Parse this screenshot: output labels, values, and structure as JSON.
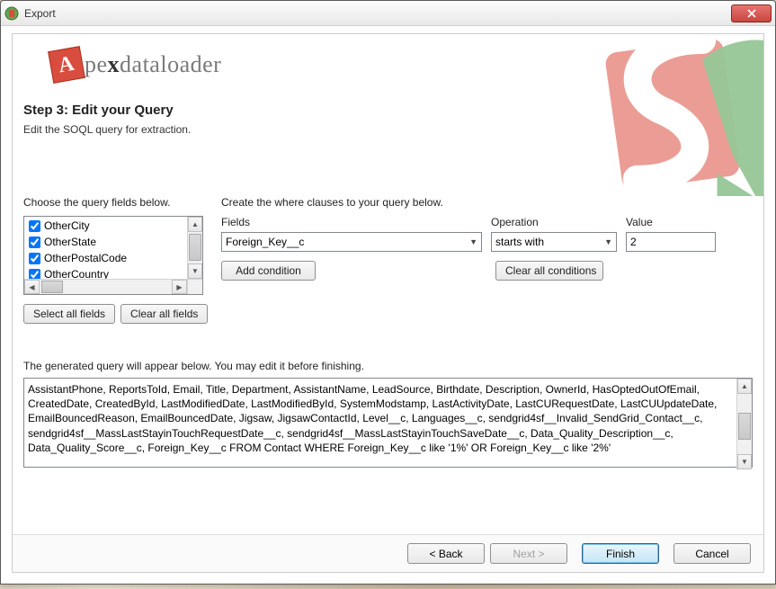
{
  "window": {
    "title": "Export"
  },
  "logo": {
    "letter": "A",
    "rest": "pe",
    "x": "x",
    "tail": "dataloader"
  },
  "step": {
    "title": "Step 3: Edit your Query",
    "desc": "Edit the SOQL query for extraction."
  },
  "left": {
    "label": "Choose the query fields below.",
    "items": [
      "OtherCity",
      "OtherState",
      "OtherPostalCode",
      "OtherCountry"
    ],
    "select_all": "Select all fields",
    "clear_all": "Clear all fields"
  },
  "where": {
    "label": "Create the where clauses to your query below.",
    "fields_label": "Fields",
    "operation_label": "Operation",
    "value_label": "Value",
    "field_value": "Foreign_Key__c",
    "operation_value": "starts with",
    "value_value": "2",
    "add": "Add condition",
    "clear": "Clear all conditions"
  },
  "generated": {
    "label": "The generated query will appear below.  You may edit it before finishing.",
    "query": "AssistantPhone, ReportsToId, Email, Title, Department, AssistantName, LeadSource, Birthdate, Description, OwnerId, HasOptedOutOfEmail, CreatedDate, CreatedById, LastModifiedDate, LastModifiedById, SystemModstamp, LastActivityDate, LastCURequestDate, LastCUUpdateDate, EmailBouncedReason, EmailBouncedDate, Jigsaw, JigsawContactId, Level__c, Languages__c, sendgrid4sf__Invalid_SendGrid_Contact__c, sendgrid4sf__MassLastStayinTouchRequestDate__c, sendgrid4sf__MassLastStayinTouchSaveDate__c, Data_Quality_Description__c, Data_Quality_Score__c, Foreign_Key__c FROM Contact WHERE Foreign_Key__c like '1%' OR Foreign_Key__c like '2%'"
  },
  "footer": {
    "back": "< Back",
    "next": "Next >",
    "finish": "Finish",
    "cancel": "Cancel"
  }
}
